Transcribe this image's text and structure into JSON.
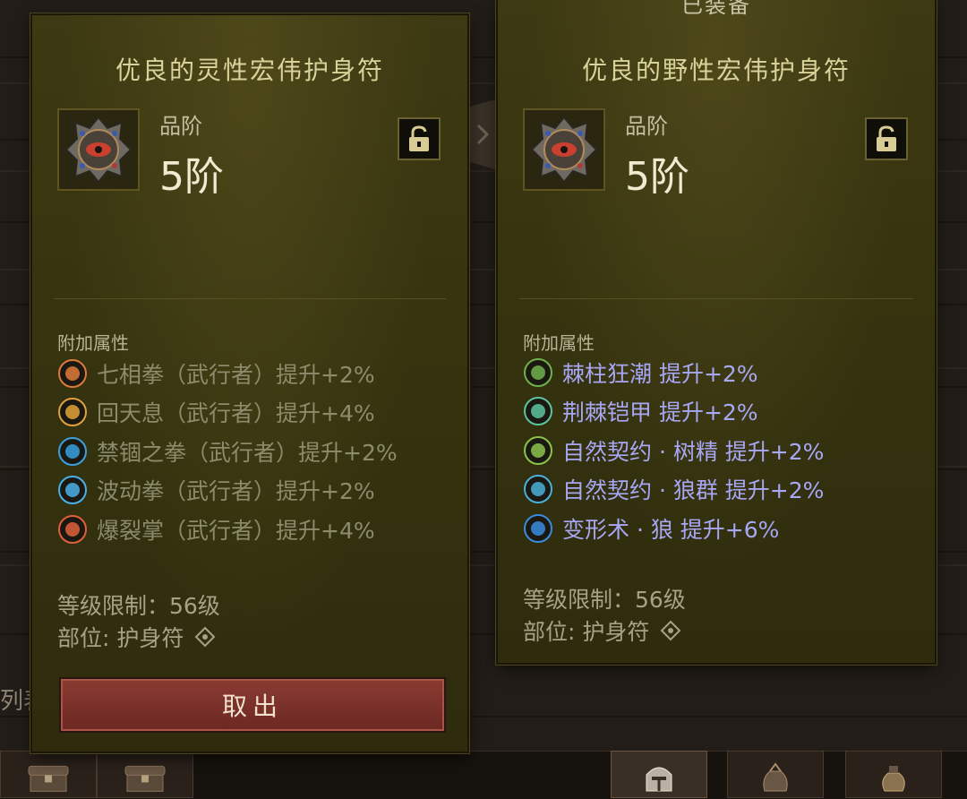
{
  "background": {
    "left_partial_text": "列表"
  },
  "left_tooltip": {
    "title": "优良的灵性宏伟护身符",
    "icon": "amulet-icon",
    "tier_label": "品阶",
    "tier_value": "5阶",
    "lock_icon": "unlock-icon",
    "affix_header": "附加属性",
    "affixes": [
      {
        "text": "七相拳（武行者）提升+2%",
        "icon": "fire-fist-icon",
        "color": "#e07a3a"
      },
      {
        "text": "回天息（武行者）提升+4%",
        "icon": "flame-breath-icon",
        "color": "#e2a23a"
      },
      {
        "text": "禁锢之拳（武行者）提升+2%",
        "icon": "bind-fist-icon",
        "color": "#3aa0e0"
      },
      {
        "text": "波动拳（武行者）提升+2%",
        "icon": "wave-fist-icon",
        "color": "#4ab0e8"
      },
      {
        "text": "爆裂掌（武行者）提升+4%",
        "icon": "explode-palm-icon",
        "color": "#e0603a"
      }
    ],
    "level_req": "等级限制：56级",
    "slot": "部位: 护身符",
    "withdraw_button": "取出"
  },
  "right_tooltip": {
    "equipped_label": "已装备",
    "title": "优良的野性宏伟护身符",
    "icon": "amulet-icon",
    "tier_label": "品阶",
    "tier_value": "5阶",
    "lock_icon": "unlock-icon",
    "affix_header": "附加属性",
    "affixes": [
      {
        "text": "棘柱狂潮  提升+2%",
        "icon": "thorn-pillar-icon",
        "color": "#6fb24c"
      },
      {
        "text": "荆棘铠甲  提升+2%",
        "icon": "thorn-armor-icon",
        "color": "#5ec4a0"
      },
      {
        "text": "自然契约 · 树精  提升+2%",
        "icon": "treant-icon",
        "color": "#8cc24c"
      },
      {
        "text": "自然契约 · 狼群  提升+2%",
        "icon": "wolf-pack-icon",
        "color": "#4ab0d8"
      },
      {
        "text": "变形术 · 狼  提升+6%",
        "icon": "wolf-form-icon",
        "color": "#3a8ce0"
      }
    ],
    "level_req": "等级限制：56级",
    "slot": "部位: 护身符"
  },
  "bottom_bar": {
    "slots": [
      "chest-icon",
      "chest-icon",
      "helmet-icon",
      "gem-pouch-icon",
      "money-bag-icon"
    ]
  },
  "colors": {
    "panel": "#36330f",
    "title": "#d9d29a",
    "affix_dim": "#8c8b6c",
    "affix_active": "#a7a7f4",
    "button": "#7a3129"
  }
}
